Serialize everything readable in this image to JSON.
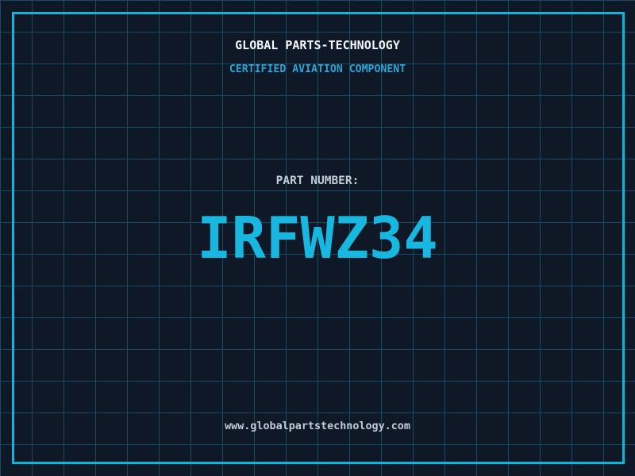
{
  "theme": {
    "bg": "#0e1827",
    "grid": "#1a4a60",
    "accent": "#0fb6dc",
    "title": "#f2f6f9",
    "subtitle": "#2aa4d4",
    "muted": "#c3ccd6",
    "partnum": "#17b7e0"
  },
  "header": {
    "title": "GLOBAL PARTS-TECHNOLOGY",
    "subtitle": "CERTIFIED AVIATION COMPONENT"
  },
  "part": {
    "label": "PART NUMBER:",
    "number": "IRFWZ34"
  },
  "footer": {
    "url": "www.globalpartstechnology.com"
  }
}
